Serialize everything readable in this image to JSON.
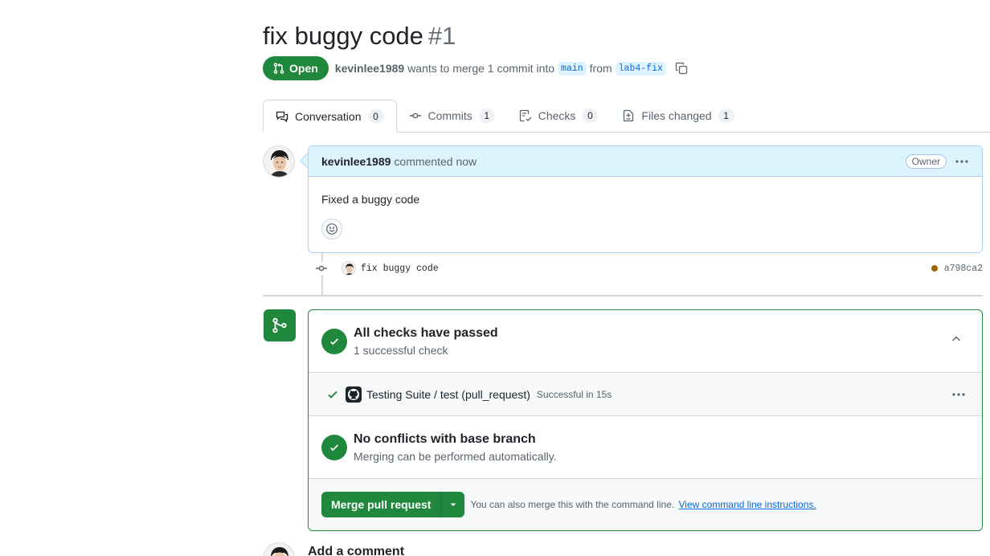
{
  "pr": {
    "title": "fix buggy code",
    "number": "#1",
    "state": "Open",
    "author": "kevinlee1989",
    "merge_text": "wants to merge 1 commit into",
    "base_branch": "main",
    "from_text": "from",
    "head_branch": "lab4-fix"
  },
  "tabs": [
    {
      "label": "Conversation",
      "count": "0"
    },
    {
      "label": "Commits",
      "count": "1"
    },
    {
      "label": "Checks",
      "count": "0"
    },
    {
      "label": "Files changed",
      "count": "1"
    }
  ],
  "comment": {
    "author": "kevinlee1989",
    "action": "commented now",
    "role": "Owner",
    "body": "Fixed a buggy code"
  },
  "commit": {
    "message": "fix buggy code",
    "sha": "a798ca2"
  },
  "checks": {
    "title": "All checks have passed",
    "subtitle": "1 successful check",
    "run_name": "Testing Suite / test (pull_request)",
    "run_status": "Successful in 15s"
  },
  "conflicts": {
    "title": "No conflicts with base branch",
    "subtitle": "Merging can be performed automatically."
  },
  "merge": {
    "button_label": "Merge pull request",
    "hint": "You can also merge this with the command line.",
    "link": "View command line instructions."
  },
  "add_comment": {
    "title": "Add a comment"
  },
  "colors": {
    "success": "#1f883d",
    "link": "#0969da",
    "comment_header": "#ddf4ff"
  }
}
